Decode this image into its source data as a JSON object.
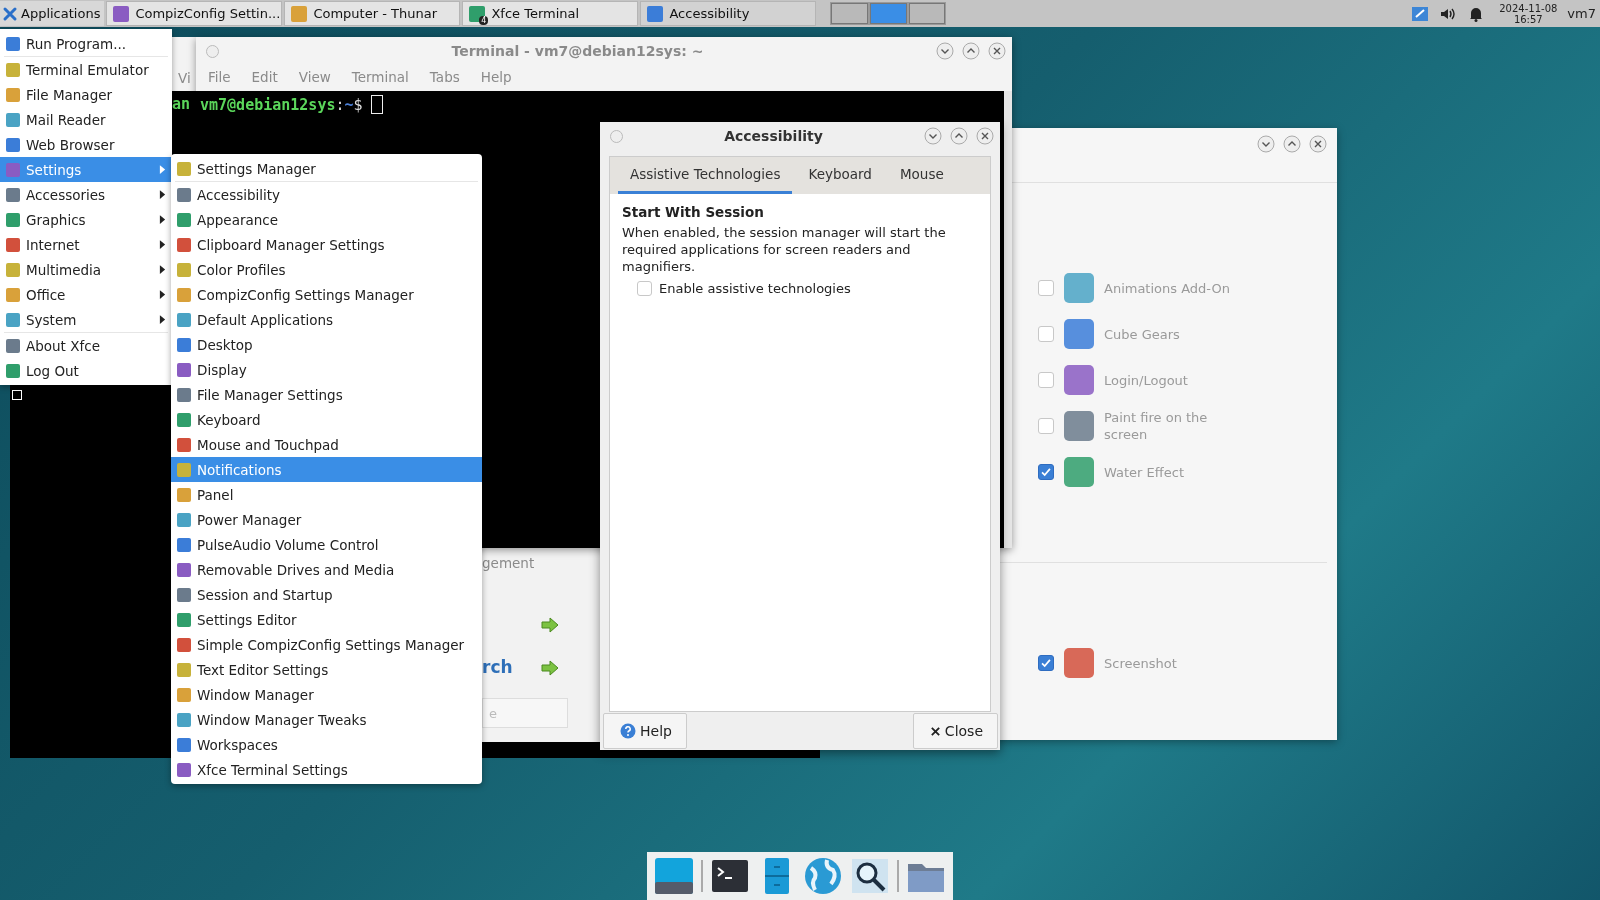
{
  "panel": {
    "apps_label": "Applications",
    "tasks": [
      {
        "label": "CompizConfig Settin...",
        "selected": false
      },
      {
        "label": "Computer - Thunar",
        "selected": false
      },
      {
        "label": "Xfce Terminal",
        "badge": "4",
        "selected": false
      },
      {
        "label": "Accessibility",
        "selected": true
      }
    ],
    "clock": {
      "date": "2024-11-08",
      "time": "16:57"
    },
    "user": "vm7"
  },
  "app_menu": {
    "groups": [
      [
        {
          "label": "Run Program...",
          "kind": "item",
          "selected": false
        }
      ],
      [
        {
          "label": "Terminal Emulator",
          "kind": "item",
          "selected": false
        },
        {
          "label": "File Manager",
          "kind": "item",
          "selected": false
        },
        {
          "label": "Mail Reader",
          "kind": "item",
          "selected": false
        },
        {
          "label": "Web Browser",
          "kind": "item",
          "selected": false
        },
        {
          "label": "Settings",
          "kind": "submenu",
          "selected": true
        },
        {
          "label": "Accessories",
          "kind": "submenu",
          "selected": false
        },
        {
          "label": "Graphics",
          "kind": "submenu",
          "selected": false
        },
        {
          "label": "Internet",
          "kind": "submenu",
          "selected": false
        },
        {
          "label": "Multimedia",
          "kind": "submenu",
          "selected": false
        },
        {
          "label": "Office",
          "kind": "submenu",
          "selected": false
        },
        {
          "label": "System",
          "kind": "submenu",
          "selected": false
        }
      ],
      [
        {
          "label": "About Xfce",
          "kind": "item",
          "selected": false
        },
        {
          "label": "Log Out",
          "kind": "item",
          "selected": false
        }
      ]
    ]
  },
  "settings_menu": {
    "groups": [
      [
        {
          "label": "Settings Manager",
          "selected": false
        }
      ],
      [
        {
          "label": "Accessibility",
          "selected": false
        },
        {
          "label": "Appearance",
          "selected": false
        },
        {
          "label": "Clipboard Manager Settings",
          "selected": false
        },
        {
          "label": "Color Profiles",
          "selected": false
        },
        {
          "label": "CompizConfig Settings Manager",
          "selected": false
        },
        {
          "label": "Default Applications",
          "selected": false
        },
        {
          "label": "Desktop",
          "selected": false
        },
        {
          "label": "Display",
          "selected": false
        },
        {
          "label": "File Manager Settings",
          "selected": false
        },
        {
          "label": "Keyboard",
          "selected": false
        },
        {
          "label": "Mouse and Touchpad",
          "selected": false
        },
        {
          "label": "Notifications",
          "selected": true
        },
        {
          "label": "Panel",
          "selected": false
        },
        {
          "label": "Power Manager",
          "selected": false
        },
        {
          "label": "PulseAudio Volume Control",
          "selected": false
        },
        {
          "label": "Removable Drives and Media",
          "selected": false
        },
        {
          "label": "Session and Startup",
          "selected": false
        },
        {
          "label": "Settings Editor",
          "selected": false
        },
        {
          "label": "Simple CompizConfig Settings Manager",
          "selected": false
        },
        {
          "label": "Text Editor Settings",
          "selected": false
        },
        {
          "label": "Window Manager",
          "selected": false
        },
        {
          "label": "Window Manager Tweaks",
          "selected": false
        },
        {
          "label": "Workspaces",
          "selected": false
        },
        {
          "label": "Xfce Terminal Settings",
          "selected": false
        }
      ]
    ]
  },
  "back_terminal": {
    "menu_fragment": "Vi",
    "prompt_fragment": "an"
  },
  "terminal": {
    "title": "Terminal - vm7@debian12sys: ~",
    "menus": [
      "File",
      "Edit",
      "View",
      "Terminal",
      "Tabs",
      "Help"
    ],
    "prompt_user": "vm7@debian12sys",
    "prompt_sep": ":",
    "prompt_path": "~",
    "prompt_sign": "$"
  },
  "hidden_window": {
    "heading_fragment": "gement",
    "link_fragment": "rch",
    "field_fragment": "e"
  },
  "accessibility": {
    "title": "Accessibility",
    "tabs": [
      {
        "label": "Assistive Technologies",
        "selected": true
      },
      {
        "label": "Keyboard",
        "selected": false
      },
      {
        "label": "Mouse",
        "selected": false
      }
    ],
    "heading": "Start With Session",
    "description": "When enabled, the session manager will start the required applications for screen readers and magnifiers.",
    "checkbox": {
      "label": "Enable assistive technologies",
      "checked": false
    },
    "help": "Help",
    "close": "Close"
  },
  "plugins": {
    "groups": [
      [
        {
          "label": "Animations Add-On",
          "checked": false
        },
        {
          "label": "Cube Gears",
          "checked": false
        },
        {
          "label": "Login/Logout",
          "checked": false
        },
        {
          "label": "Paint fire on the screen",
          "checked": false
        },
        {
          "label": "Water Effect",
          "checked": true
        }
      ],
      [
        {
          "label": "Screenshot",
          "checked": true
        }
      ]
    ]
  }
}
